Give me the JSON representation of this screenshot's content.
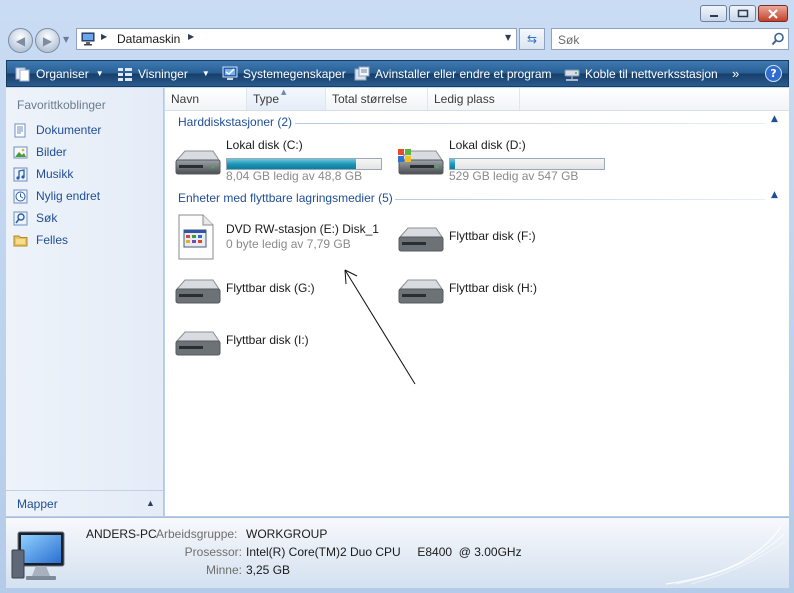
{
  "address": {
    "path": "Datamaskin"
  },
  "search": {
    "placeholder": "Søk"
  },
  "toolbar": {
    "organize": "Organiser",
    "views": "Visninger",
    "system_properties": "Systemegenskaper",
    "uninstall": "Avinstaller eller endre et program",
    "map_drive": "Koble til nettverksstasjon",
    "more": "»",
    "help": "?"
  },
  "nav": {
    "header": "Favorittkoblinger",
    "items": [
      {
        "label": "Dokumenter",
        "icon": "documents-icon"
      },
      {
        "label": "Bilder",
        "icon": "pictures-icon"
      },
      {
        "label": "Musikk",
        "icon": "music-icon"
      },
      {
        "label": "Nylig endret",
        "icon": "recently-changed-icon"
      },
      {
        "label": "Søk",
        "icon": "search-folder-icon"
      },
      {
        "label": "Felles",
        "icon": "public-folder-icon"
      }
    ],
    "folders_label": "Mapper"
  },
  "columns": [
    "Navn",
    "Type",
    "Total størrelse",
    "Ledig plass"
  ],
  "groups": {
    "hdd": {
      "title": "Harddiskstasjoner (2)",
      "drives": [
        {
          "name": "Lokal disk (C:)",
          "free": "8,04 GB ledig av 48,8 GB",
          "used_fraction": 0.835
        },
        {
          "name": "Lokal disk (D:)",
          "free": "529 GB ledig av 547 GB",
          "used_fraction": 0.033
        }
      ]
    },
    "removable": {
      "title": "Enheter med flyttbare lagringsmedier (5)",
      "devices": [
        {
          "name": "DVD RW-stasjon (E:) Disk_1",
          "free": "0 byte ledig av 7,79 GB"
        },
        {
          "name": "Flyttbar disk (F:)"
        },
        {
          "name": "Flyttbar disk (G:)"
        },
        {
          "name": "Flyttbar disk (H:)"
        },
        {
          "name": "Flyttbar disk (I:)"
        }
      ]
    }
  },
  "details": {
    "computer_name": "ANDERS-PC",
    "workgroup_label": "Arbeidsgruppe:",
    "workgroup": "WORKGROUP",
    "cpu_label": "Prosessor:",
    "cpu": "Intel(R) Core(TM)2 Duo CPU     E8400  @ 3.00GHz",
    "memory_label": "Minne:",
    "memory": "3,25 GB"
  },
  "colors": {
    "toolbar": "#285f95",
    "link": "#1f4e96",
    "drive_bar": "#1a93b3"
  }
}
